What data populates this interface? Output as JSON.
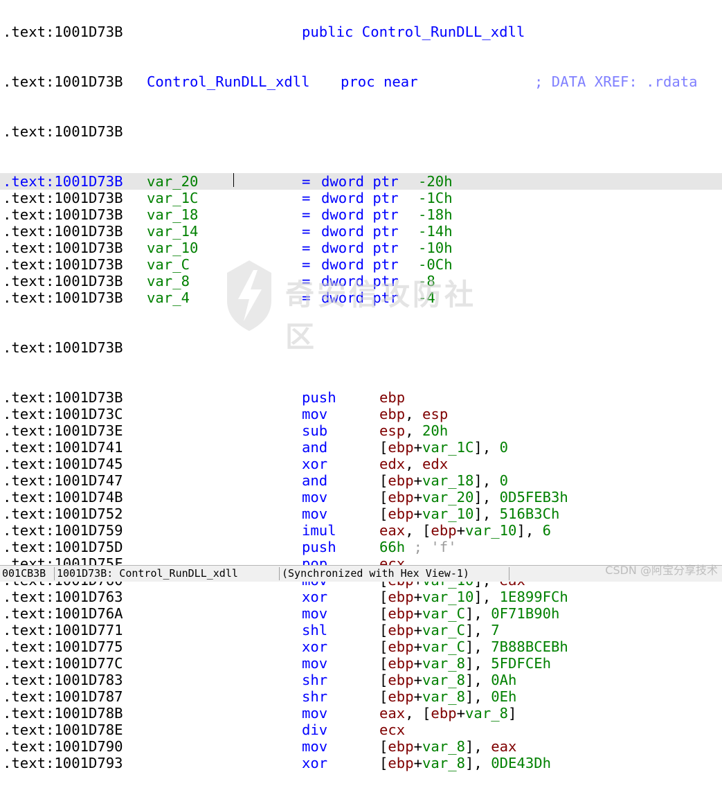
{
  "listing": {
    "header_partial": {
      "addr": ".text:1001D73B",
      "text": "public Control_RunDLL_xdll"
    },
    "proc_line": {
      "addr": ".text:1001D73B",
      "name": "Control_RunDLL_xdll",
      "kw": "proc near",
      "comment": "; DATA XREF: .rdata"
    },
    "blank_addr_1": ".text:1001D73B",
    "vars": [
      {
        "addr": ".text:1001D73B",
        "name": "var_20",
        "eq": "=",
        "type": "dword ptr",
        "val": "-20h"
      },
      {
        "addr": ".text:1001D73B",
        "name": "var_1C",
        "eq": "=",
        "type": "dword ptr",
        "val": "-1Ch"
      },
      {
        "addr": ".text:1001D73B",
        "name": "var_18",
        "eq": "=",
        "type": "dword ptr",
        "val": "-18h"
      },
      {
        "addr": ".text:1001D73B",
        "name": "var_14",
        "eq": "=",
        "type": "dword ptr",
        "val": "-14h"
      },
      {
        "addr": ".text:1001D73B",
        "name": "var_10",
        "eq": "=",
        "type": "dword ptr",
        "val": "-10h"
      },
      {
        "addr": ".text:1001D73B",
        "name": "var_C",
        "eq": "=",
        "type": "dword ptr",
        "val": "-0Ch"
      },
      {
        "addr": ".text:1001D73B",
        "name": "var_8",
        "eq": "=",
        "type": "dword ptr",
        "val": "-8"
      },
      {
        "addr": ".text:1001D73B",
        "name": "var_4",
        "eq": "=",
        "type": "dword ptr",
        "val": "-4"
      }
    ],
    "blank_addr_2": ".text:1001D73B",
    "instructions": [
      {
        "addr": ".text:1001D73B",
        "mn": "push",
        "a": "ebp"
      },
      {
        "addr": ".text:1001D73C",
        "mn": "mov",
        "a": "ebp",
        "b": "esp"
      },
      {
        "addr": ".text:1001D73E",
        "mn": "sub",
        "a": "esp",
        "b": "20h"
      },
      {
        "addr": ".text:1001D741",
        "mn": "and",
        "var": "var_1C",
        "b": "0"
      },
      {
        "addr": ".text:1001D745",
        "mn": "xor",
        "a": "edx",
        "b": "edx"
      },
      {
        "addr": ".text:1001D747",
        "mn": "and",
        "var": "var_18",
        "b": "0"
      },
      {
        "addr": ".text:1001D74B",
        "mn": "mov",
        "var": "var_20",
        "b": "0D5FEB3h"
      },
      {
        "addr": ".text:1001D752",
        "mn": "mov",
        "var": "var_10",
        "b": "516B3Ch"
      },
      {
        "addr": ".text:1001D759",
        "mn": "imul",
        "a": "eax",
        "var": "var_10",
        "c": "6"
      },
      {
        "addr": ".text:1001D75D",
        "mn": "push",
        "a": "66h",
        "comment": "; 'f'"
      },
      {
        "addr": ".text:1001D75F",
        "mn": "pop",
        "a": "ecx"
      },
      {
        "addr": ".text:1001D760",
        "mn": "mov",
        "var": "var_10",
        "b": "eax"
      },
      {
        "addr": ".text:1001D763",
        "mn": "xor",
        "var": "var_10",
        "b": "1E899FCh"
      },
      {
        "addr": ".text:1001D76A",
        "mn": "mov",
        "var": "var_C",
        "b": "0F71B90h"
      },
      {
        "addr": ".text:1001D771",
        "mn": "shl",
        "var": "var_C",
        "b": "7"
      },
      {
        "addr": ".text:1001D775",
        "mn": "xor",
        "var": "var_C",
        "b": "7B88BCEBh"
      },
      {
        "addr": ".text:1001D77C",
        "mn": "mov",
        "var": "var_8",
        "b": "5FDFCEh"
      },
      {
        "addr": ".text:1001D783",
        "mn": "shr",
        "var": "var_8",
        "b": "0Ah"
      },
      {
        "addr": ".text:1001D787",
        "mn": "shr",
        "var": "var_8",
        "b": "0Eh"
      },
      {
        "addr": ".text:1001D78B",
        "mn": "mov",
        "a": "eax",
        "var2": "var_8"
      },
      {
        "addr": ".text:1001D78E",
        "mn": "div",
        "a": "ecx"
      },
      {
        "addr": ".text:1001D790",
        "mn": "mov",
        "var": "var_8",
        "b": "eax"
      },
      {
        "addr": ".text:1001D793",
        "mn": "xor",
        "var": "var_8",
        "b": "0DE43Dh"
      }
    ]
  },
  "watermark": {
    "text": "奇安信攻防社区"
  },
  "status": {
    "offset": "001CB3B",
    "location": "1001D73B: Control_RunDLL_xdll",
    "sync": "(Synchronized with Hex View-1)"
  },
  "credit": "CSDN @阿宝分享技术",
  "colors": {
    "register": "#7f0000",
    "variable": "#008000",
    "keyword": "#0000ff",
    "highlight": "#e6e6e6"
  }
}
